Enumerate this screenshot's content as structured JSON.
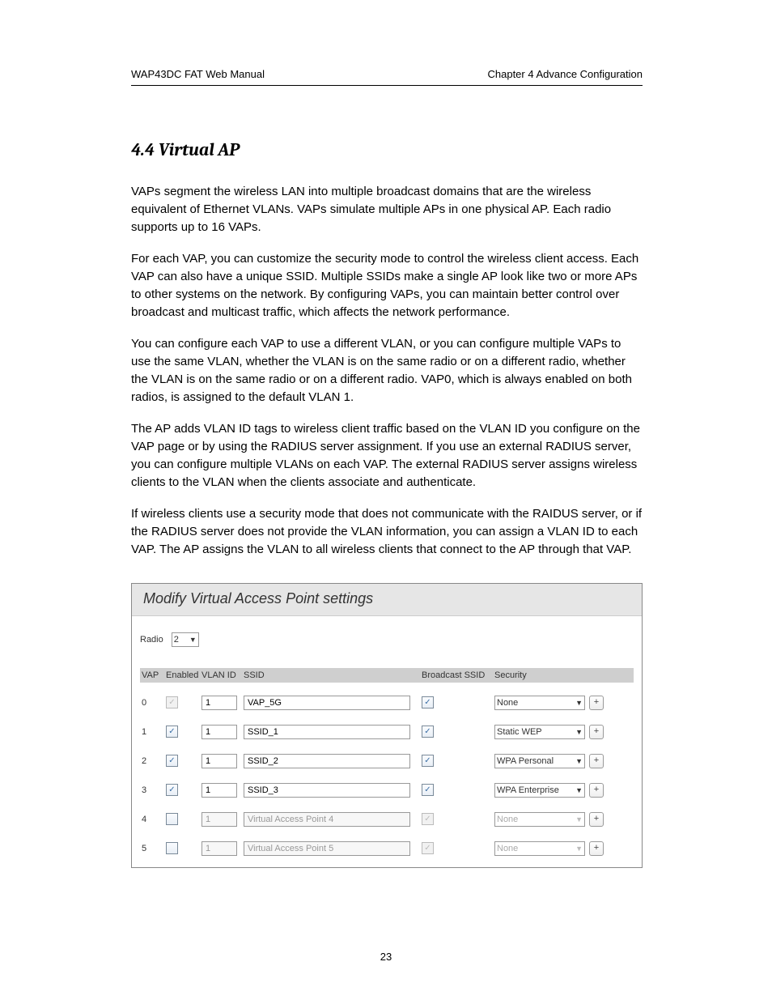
{
  "header": {
    "left": "WAP43DC FAT Web Manual",
    "right": "Chapter 4 Advance Configuration"
  },
  "section_title": "4.4 Virtual AP",
  "paragraphs": [
    "VAPs segment the wireless LAN into multiple broadcast domains that are the wireless equivalent of Ethernet VLANs. VAPs simulate multiple APs in one physical AP. Each radio supports up to 16 VAPs.",
    "For each VAP, you can customize the security mode to control the wireless client access. Each VAP can also have a unique SSID. Multiple SSIDs make a single AP look like two or more APs to other systems on the network. By configuring VAPs, you can maintain better control over broadcast and multicast traffic, which affects the network performance.",
    "You can configure each VAP to use a different VLAN, or you can configure multiple VAPs to use the same VLAN, whether the VLAN is on the same radio or on a different radio, whether the VLAN is on the same radio or on a different radio. VAP0, which is always enabled on both radios, is assigned to the default VLAN 1.",
    "The AP adds VLAN ID tags to wireless client traffic based on the VLAN ID you configure on the VAP page or by using the RADIUS server assignment. If you use an external RADIUS server, you can configure multiple VLANs on each VAP. The external RADIUS server assigns wireless clients to the VLAN when the clients associate and authenticate.",
    "If wireless clients use a security mode that does not communicate with the RAIDUS server, or if the RADIUS server does not provide the VLAN information, you can assign a VLAN ID to each VAP. The AP assigns the VLAN to all wireless clients that connect to the AP through that VAP."
  ],
  "screenshot": {
    "title": "Modify Virtual Access Point settings",
    "radio_label": "Radio",
    "radio_value": "2",
    "columns": {
      "vap": "VAP",
      "enabled": "Enabled",
      "vlan": "VLAN ID",
      "ssid": "SSID",
      "bcast": "Broadcast SSID",
      "security": "Security"
    },
    "rows": [
      {
        "vap": "0",
        "enabled_checked": true,
        "enabled_disabled": true,
        "vlan": "1",
        "ssid": "VAP_5G",
        "bcast_checked": true,
        "bcast_disabled": false,
        "security": "None",
        "sec_disabled": false,
        "ssid_disabled": false
      },
      {
        "vap": "1",
        "enabled_checked": true,
        "enabled_disabled": false,
        "vlan": "1",
        "ssid": "SSID_1",
        "bcast_checked": true,
        "bcast_disabled": false,
        "security": "Static WEP",
        "sec_disabled": false,
        "ssid_disabled": false
      },
      {
        "vap": "2",
        "enabled_checked": true,
        "enabled_disabled": false,
        "vlan": "1",
        "ssid": "SSID_2",
        "bcast_checked": true,
        "bcast_disabled": false,
        "security": "WPA Personal",
        "sec_disabled": false,
        "ssid_disabled": false
      },
      {
        "vap": "3",
        "enabled_checked": true,
        "enabled_disabled": false,
        "vlan": "1",
        "ssid": "SSID_3",
        "bcast_checked": true,
        "bcast_disabled": false,
        "security": "WPA Enterprise",
        "sec_disabled": false,
        "ssid_disabled": false
      },
      {
        "vap": "4",
        "enabled_checked": false,
        "enabled_disabled": false,
        "vlan": "1",
        "ssid": "Virtual Access Point 4",
        "bcast_checked": true,
        "bcast_disabled": true,
        "security": "None",
        "sec_disabled": true,
        "ssid_disabled": true
      },
      {
        "vap": "5",
        "enabled_checked": false,
        "enabled_disabled": false,
        "vlan": "1",
        "ssid": "Virtual Access Point 5",
        "bcast_checked": true,
        "bcast_disabled": true,
        "security": "None",
        "sec_disabled": true,
        "ssid_disabled": true
      }
    ]
  },
  "page_number": "23"
}
